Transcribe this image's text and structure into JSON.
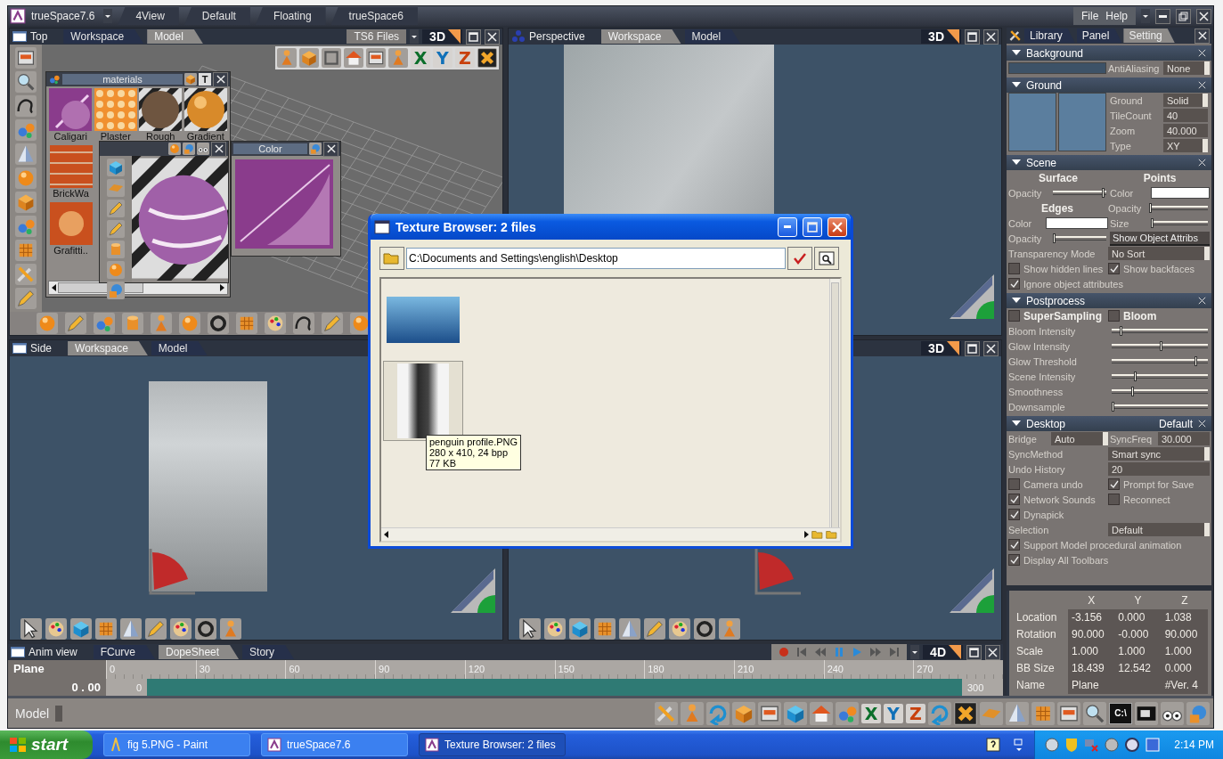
{
  "app_bar": {
    "title": "trueSpace7.6",
    "layouts": [
      "4View",
      "Default",
      "Floating",
      "trueSpace6"
    ],
    "menus": [
      "File",
      "Help"
    ]
  },
  "viewports": [
    {
      "kind": "top",
      "title": "Top",
      "tabs": [
        {
          "label": "Workspace",
          "selected": false
        },
        {
          "label": "Model",
          "selected": true
        }
      ],
      "files_button": "TS6 Files",
      "mode": "3D",
      "axis_letters": [
        "X",
        "Y",
        "Z"
      ],
      "materials": {
        "title": "materials",
        "text_button": "T",
        "items": [
          "Caligari",
          "Plaster",
          "Rough",
          "Gradient",
          "BrickWa",
          "Grafitti.."
        ]
      },
      "color_window": {
        "title": "Color"
      }
    },
    {
      "kind": "perspective",
      "title": "Perspective",
      "tabs": [
        {
          "label": "Workspace",
          "selected": true
        },
        {
          "label": "Model",
          "selected": false
        }
      ],
      "mode": "3D"
    },
    {
      "kind": "side",
      "title": "Side",
      "tabs": [
        {
          "label": "Workspace",
          "selected": true
        },
        {
          "label": "Model",
          "selected": false
        }
      ]
    },
    {
      "kind": "camera",
      "mode": "3D"
    }
  ],
  "texture_browser": {
    "title": "Texture Browser: 2 files",
    "path": "C:\\Documents and Settings\\english\\Desktop",
    "files": [
      {
        "kind": "landscape",
        "selected": false
      },
      {
        "kind": "portrait",
        "selected": true
      }
    ],
    "tooltip": [
      "penguin profile.PNG",
      "280 x 410, 24 bpp",
      "77 KB"
    ]
  },
  "settings_panel": {
    "tabs": [
      {
        "label": "Library",
        "selected": false
      },
      {
        "label": "Panel",
        "selected": false
      },
      {
        "label": "Setting",
        "selected": true
      }
    ],
    "background": {
      "title": "Background",
      "label": "AntiAliasing",
      "value": "None"
    },
    "ground": {
      "title": "Ground",
      "fields": [
        {
          "label": "Ground",
          "value": "Solid",
          "kind": "dropdown"
        },
        {
          "label": "TileCount",
          "value": "40",
          "kind": "input"
        },
        {
          "label": "Zoom",
          "value": "40.000",
          "kind": "input"
        },
        {
          "label": "Type",
          "value": "XY",
          "kind": "dropdown"
        }
      ]
    },
    "scene": {
      "title": "Scene",
      "surface": {
        "heading": "Surface",
        "opacity": {
          "label": "Opacity",
          "level": 0.95
        }
      },
      "points": {
        "heading": "Points",
        "color_label": "Color",
        "opacity": {
          "label": "Opacity",
          "level": 0.03
        },
        "size": {
          "label": "Size",
          "level": 0.03
        }
      },
      "edges": {
        "heading": "Edges",
        "color_label": "Color",
        "opacity": {
          "label": "Opacity",
          "level": 0.03
        }
      },
      "attribs_button": "Show Object Attribs",
      "transparency_label": "Transparency Mode",
      "transparency_value": "No Sort",
      "checks": [
        {
          "label": "Show hidden lines",
          "checked": false
        },
        {
          "label": "Show backfaces",
          "checked": true
        },
        {
          "label": "Ignore object attributes",
          "checked": true
        }
      ]
    },
    "postprocess": {
      "title": "Postprocess",
      "toggles": [
        {
          "label": "SuperSampling",
          "checked": false
        },
        {
          "label": "Bloom",
          "checked": false
        }
      ],
      "sliders": [
        {
          "label": "Bloom Intensity",
          "level": 0.1
        },
        {
          "label": "Glow Intensity",
          "level": 0.52
        },
        {
          "label": "Glow Threshold",
          "level": 0.88
        },
        {
          "label": "Scene Intensity",
          "level": 0.25
        },
        {
          "label": "Smoothness",
          "level": 0.22
        },
        {
          "label": "Downsample",
          "level": 0.02
        }
      ]
    },
    "desktop": {
      "title": "Desktop",
      "preset": "Default",
      "rows": [
        {
          "kind": "pair",
          "items": [
            {
              "label": "Bridge",
              "value": "Auto",
              "kind": "dropdown"
            },
            {
              "label": "SyncFreq",
              "value": "30.000",
              "kind": "input"
            }
          ]
        },
        {
          "kind": "dropdown",
          "label": "SyncMethod",
          "value": "Smart sync"
        },
        {
          "kind": "input",
          "label": "Undo History",
          "value": "20"
        },
        {
          "kind": "checks",
          "items": [
            {
              "label": "Camera undo",
              "checked": false
            },
            {
              "label": "Prompt for Save",
              "checked": true
            }
          ]
        },
        {
          "kind": "checks",
          "items": [
            {
              "label": "Network Sounds",
              "checked": true
            },
            {
              "label": "Reconnect",
              "checked": false
            }
          ]
        },
        {
          "kind": "checks",
          "items": [
            {
              "label": "Dynapick",
              "checked": true
            }
          ]
        },
        {
          "kind": "dropdown",
          "label": "Selection",
          "value": "Default"
        },
        {
          "kind": "checks",
          "items": [
            {
              "label": "Support Model procedural animation",
              "checked": true
            }
          ]
        },
        {
          "kind": "checks",
          "items": [
            {
              "label": "Display All Toolbars",
              "checked": true
            }
          ]
        }
      ]
    }
  },
  "transform": {
    "columns": [
      "X",
      "Y",
      "Z"
    ],
    "rows": [
      {
        "label": "Location",
        "values": [
          "-3.156",
          "0.000",
          "1.038"
        ]
      },
      {
        "label": "Rotation",
        "values": [
          "90.000",
          "-0.000",
          "90.000"
        ]
      },
      {
        "label": "Scale",
        "values": [
          "1.000",
          "1.000",
          "1.000"
        ]
      },
      {
        "label": "BB Size",
        "values": [
          "18.439",
          "12.542",
          "0.000"
        ]
      }
    ],
    "name_label": "Name",
    "name_value": "Plane",
    "version": "#Ver. 4"
  },
  "anim_view": {
    "title": "Anim view",
    "tabs": [
      {
        "label": "FCurve",
        "selected": false
      },
      {
        "label": "DopeSheet",
        "selected": true
      },
      {
        "label": "Story",
        "selected": false
      }
    ],
    "object": "Plane",
    "time": "0 . 00",
    "ticks": [
      "0",
      "30",
      "60",
      "90",
      "120",
      "150",
      "180",
      "210",
      "240",
      "270"
    ],
    "start": "0",
    "end": "300",
    "mode": "4D"
  },
  "model_bar": {
    "label": "Model",
    "axis_letters": [
      "X",
      "Y",
      "Z"
    ],
    "console_label": "C:\\"
  },
  "taskbar": {
    "start": "start",
    "tasks": [
      {
        "label": "fig 5.PNG - Paint",
        "selected": false
      },
      {
        "label": "trueSpace7.6",
        "selected": false
      },
      {
        "label": "Texture Browser: 2 files",
        "selected": true
      }
    ],
    "clock": "2:14 PM"
  }
}
